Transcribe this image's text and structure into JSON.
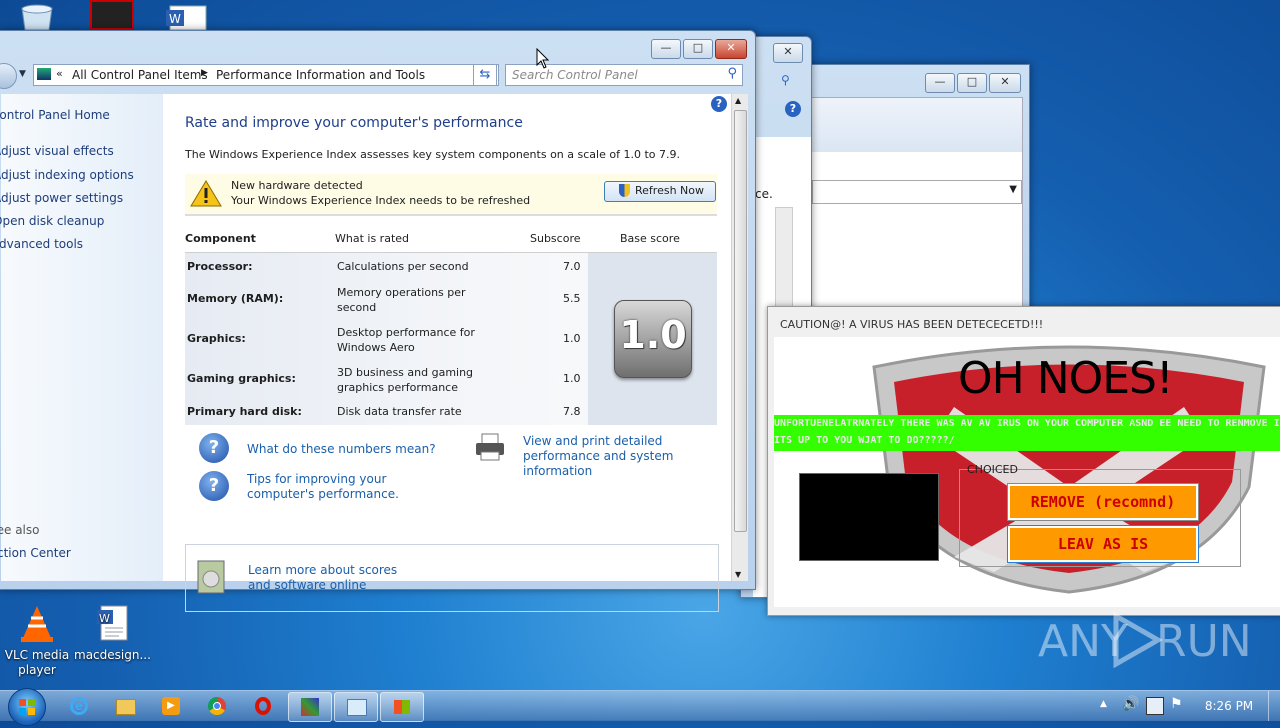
{
  "desktop": {
    "icons": [
      {
        "label": "VLC media player"
      },
      {
        "label": "macdesign..."
      }
    ]
  },
  "control_panel": {
    "breadcrumb": [
      "All Control Panel Items",
      "Performance Information and Tools"
    ],
    "search_placeholder": "Search Control Panel",
    "left_links": [
      "Control Panel Home",
      "Adjust visual effects",
      "Adjust indexing options",
      "Adjust power settings",
      "Open disk cleanup",
      "Advanced tools"
    ],
    "see_also_label": "See also",
    "see_also_links": [
      "Action Center"
    ],
    "heading": "Rate and improve your computer's performance",
    "intro": "The Windows Experience Index assesses key system components on a scale of 1.0 to 7.9.",
    "notice_title": "New hardware detected",
    "notice_body": "Your Windows Experience Index needs to be refreshed",
    "refresh_label": "Refresh Now",
    "columns": [
      "Component",
      "What is rated",
      "Subscore",
      "Base score"
    ],
    "rows": [
      {
        "component": "Processor:",
        "rated": "Calculations per second",
        "subscore": "7.0"
      },
      {
        "component": "Memory (RAM):",
        "rated": "Memory operations per second",
        "subscore": "5.5"
      },
      {
        "component": "Graphics:",
        "rated": "Desktop performance for Windows Aero",
        "subscore": "1.0"
      },
      {
        "component": "Gaming graphics:",
        "rated": "3D business and gaming graphics performance",
        "subscore": "1.0"
      },
      {
        "component": "Primary hard disk:",
        "rated": "Disk data transfer rate",
        "subscore": "7.8"
      }
    ],
    "base_score": "1.0",
    "link_numbers": "What do these numbers mean?",
    "link_tips": "Tips for improving your computer's performance.",
    "link_print": "View and print detailed performance and system information",
    "link_learn": "Learn more about scores and software online"
  },
  "caution": {
    "title": "CAUTION@! A VIRUS HAS BEEN DETECECETD!!!",
    "headline": "OH NOES!",
    "banner": "UNFORTUENELATRNATELY THERE WAS AV AV IRUS ON YOUR COMPUTER ASND EE NEED TO RENMOVE IT BUT ITS UP TO YOU WJAT TO DO?????/",
    "group_label": "CHOICED",
    "remove_label": "REMOVE (recomnd)",
    "leave_label": "LEAV AS IS"
  },
  "watermark": {
    "left": "ANY",
    "right": "RUN"
  },
  "taskbar": {
    "clock": "8:26 PM"
  },
  "colors": {
    "banner": "#33ff00",
    "button": "#ff9900",
    "button_text": "#cc0000"
  }
}
